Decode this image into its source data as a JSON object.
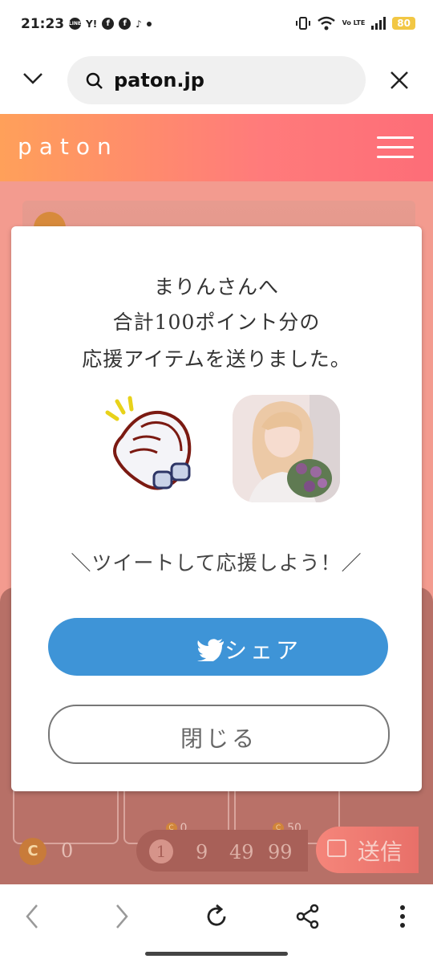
{
  "status_bar": {
    "time": "21:23",
    "apps": [
      "LINE",
      "Y!",
      "f",
      "f",
      "tiktok"
    ],
    "battery": "80",
    "network": "Vo LTE"
  },
  "browser": {
    "url": "paton.jp"
  },
  "site": {
    "logo": "paton"
  },
  "background": {
    "gift_cards": [
      {
        "name": "...",
        "points": "0"
      },
      {
        "name": "...",
        "points": "50"
      }
    ],
    "wallet_points": "0",
    "amount_options": [
      "1",
      "9",
      "49",
      "99"
    ],
    "send_label": "送信"
  },
  "modal": {
    "message_lines": [
      "まりんさんへ",
      "合計100ポイント分の",
      "応援アイテムを送りました。"
    ],
    "item_icon": "clapping-hands-icon",
    "tweet_prompt": "＼ツイートして応援しよう！／",
    "share_label": "シェア",
    "close_label": "閉じる"
  },
  "colors": {
    "header_gradient_start": "#ffa05a",
    "header_gradient_end": "#fd6d78",
    "share_button": "#3e94d7"
  }
}
